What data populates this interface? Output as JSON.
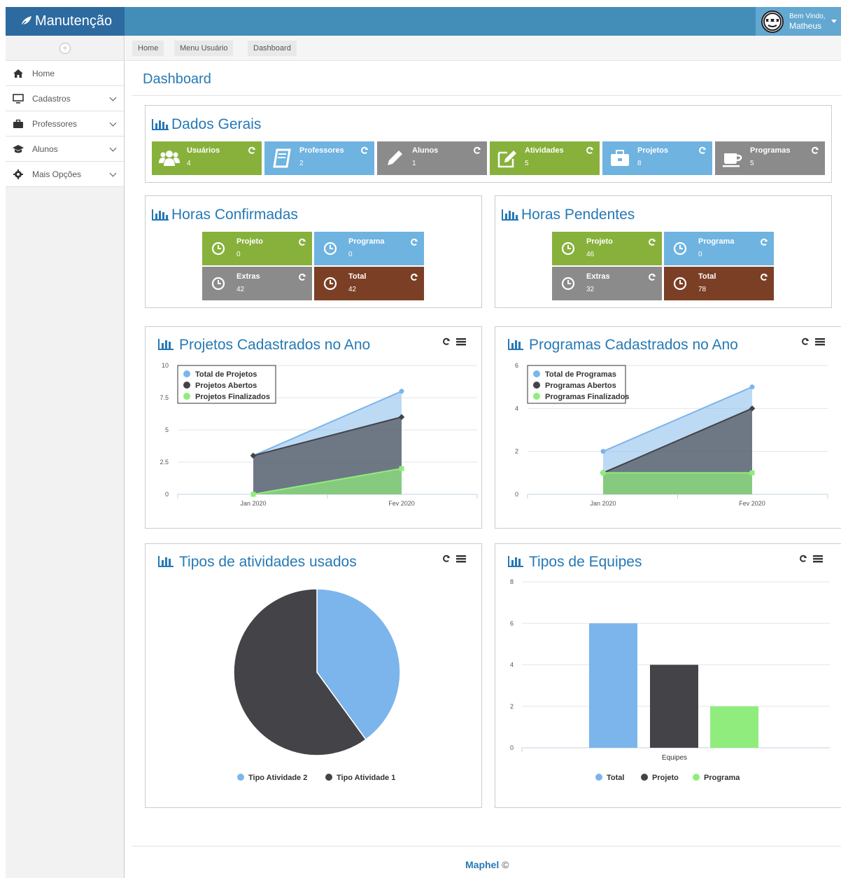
{
  "brand": {
    "title": "Manutenção"
  },
  "user": {
    "welcome": "Bem Vindo,",
    "name": "Matheus"
  },
  "sidebar": {
    "items": [
      {
        "label": "Home",
        "icon": "home-icon",
        "expandable": false
      },
      {
        "label": "Cadastros",
        "icon": "desktop-icon",
        "expandable": true
      },
      {
        "label": "Professores",
        "icon": "briefcase-icon",
        "expandable": true
      },
      {
        "label": "Alunos",
        "icon": "graduation-cap-icon",
        "expandable": true
      },
      {
        "label": "Mais Opções",
        "icon": "cog-icon",
        "expandable": true
      }
    ]
  },
  "breadcrumbs": [
    "Home",
    "Menu Usuário",
    "Dashboard"
  ],
  "page_title": "Dashboard",
  "dados_gerais": {
    "title": "Dados Gerais",
    "tiles": [
      {
        "label": "Usuários",
        "value": "4",
        "color": "#87b13b",
        "icon": "users-icon"
      },
      {
        "label": "Professores",
        "value": "2",
        "color": "#6fb3e0",
        "icon": "book-icon"
      },
      {
        "label": "Alunos",
        "value": "1",
        "color": "#8b8b8b",
        "icon": "pencil-icon"
      },
      {
        "label": "Atividades",
        "value": "5",
        "color": "#87b13b",
        "icon": "edit-icon"
      },
      {
        "label": "Projetos",
        "value": "8",
        "color": "#6fb3e0",
        "icon": "briefcase-icon"
      },
      {
        "label": "Programas",
        "value": "5",
        "color": "#8b8b8b",
        "icon": "coffee-icon"
      }
    ]
  },
  "horas_confirmadas": {
    "title": "Horas Confirmadas",
    "tiles": [
      {
        "label": "Projeto",
        "value": "0"
      },
      {
        "label": "Programa",
        "value": "0"
      },
      {
        "label": "Extras",
        "value": "42"
      },
      {
        "label": "Total",
        "value": "42"
      }
    ]
  },
  "horas_pendentes": {
    "title": "Horas Pendentes",
    "tiles": [
      {
        "label": "Projeto",
        "value": "46"
      },
      {
        "label": "Programa",
        "value": "0"
      },
      {
        "label": "Extras",
        "value": "32"
      },
      {
        "label": "Total",
        "value": "78"
      }
    ]
  },
  "chart_data": [
    {
      "type": "area",
      "title": "Projetos Cadastrados no Ano",
      "categories": [
        "Jan 2020",
        "Fev 2020"
      ],
      "ylim": [
        0,
        10
      ],
      "yticks": [
        "0",
        "2.5",
        "5",
        "7.5",
        "10"
      ],
      "legend": "top-left",
      "series": [
        {
          "name": "Total de Projetos",
          "values": [
            3,
            8
          ],
          "color": "#7cb5ec"
        },
        {
          "name": "Projetos Abertos",
          "values": [
            3,
            6
          ],
          "color": "#434348"
        },
        {
          "name": "Projetos Finalizados",
          "values": [
            0,
            2
          ],
          "color": "#90ed7d"
        }
      ]
    },
    {
      "type": "area",
      "title": "Programas Cadastrados no Ano",
      "categories": [
        "Jan 2020",
        "Fev 2020"
      ],
      "ylim": [
        0,
        6
      ],
      "yticks": [
        "0",
        "2",
        "4",
        "6"
      ],
      "legend": "top-left",
      "series": [
        {
          "name": "Total de Programas",
          "values": [
            2,
            5
          ],
          "color": "#7cb5ec"
        },
        {
          "name": "Programas Abertos",
          "values": [
            1,
            4
          ],
          "color": "#434348"
        },
        {
          "name": "Programas Finalizados",
          "values": [
            1,
            1
          ],
          "color": "#90ed7d"
        }
      ]
    },
    {
      "type": "pie",
      "title": "Tipos de atividades usados",
      "slices": [
        {
          "name": "Tipo Atividade 2",
          "value": 2,
          "color": "#7cb5ec"
        },
        {
          "name": "Tipo Atividade 1",
          "value": 3,
          "color": "#434348"
        }
      ],
      "legend": "bottom"
    },
    {
      "type": "bar",
      "title": "Tipos de Equipes",
      "categories": [
        "Equipes"
      ],
      "ylim": [
        0,
        8
      ],
      "yticks": [
        "0",
        "2",
        "4",
        "6",
        "8"
      ],
      "legend": "bottom",
      "series": [
        {
          "name": "Total",
          "values": [
            6
          ],
          "color": "#7cb5ec"
        },
        {
          "name": "Projeto",
          "values": [
            4
          ],
          "color": "#434348"
        },
        {
          "name": "Programa",
          "values": [
            2
          ],
          "color": "#90ed7d"
        }
      ]
    }
  ],
  "footer": {
    "brand": "Maphel",
    "mark": "©"
  }
}
